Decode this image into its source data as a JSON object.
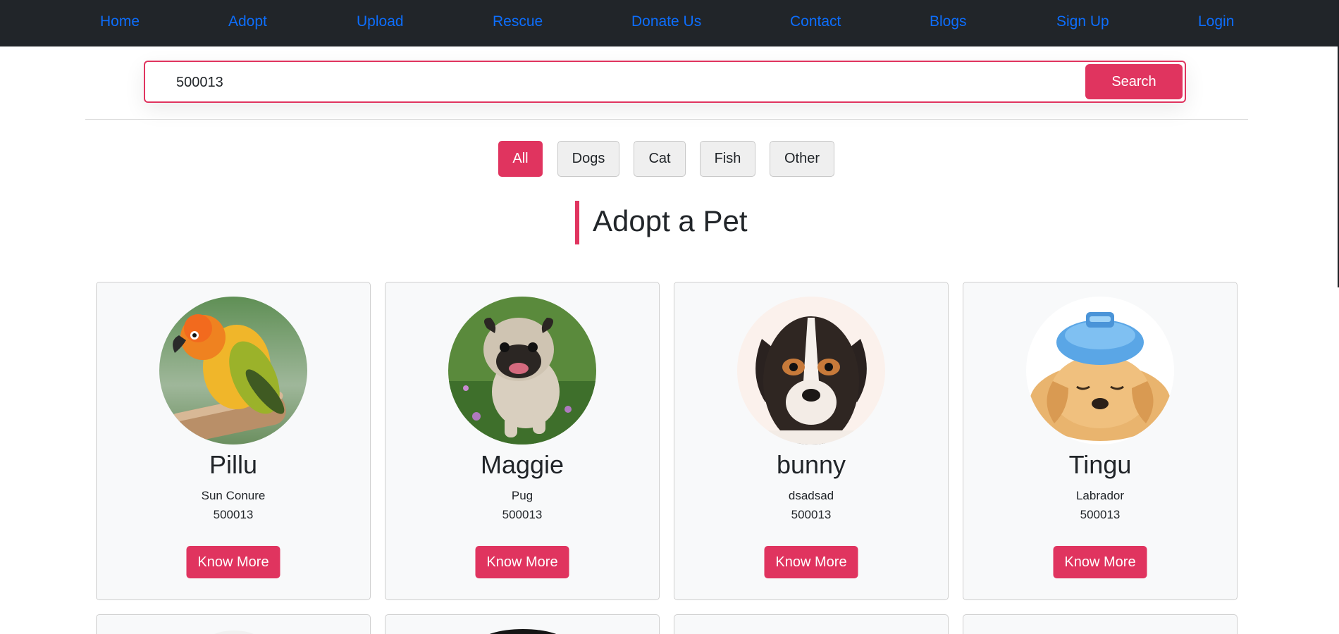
{
  "nav": {
    "items": [
      "Home",
      "Adopt",
      "Upload",
      "Rescue",
      "Donate Us",
      "Contact",
      "Blogs",
      "Sign Up",
      "Login"
    ]
  },
  "search": {
    "value": "500013",
    "button_label": "Search"
  },
  "filters": [
    "All",
    "Dogs",
    "Cat",
    "Fish",
    "Other"
  ],
  "active_filter": "All",
  "heading": "Adopt a Pet",
  "colors": {
    "accent": "#e0345f",
    "nav_bg": "#212529",
    "link": "#0d6efd"
  },
  "pets": [
    {
      "name": "Pillu",
      "breed": "Sun Conure",
      "pincode": "500013",
      "button_label": "Know More",
      "image": "parrot-photo"
    },
    {
      "name": "Maggie",
      "breed": "Pug",
      "pincode": "500013",
      "button_label": "Know More",
      "image": "pug-photo"
    },
    {
      "name": "bunny",
      "breed": "dsadsad",
      "pincode": "500013",
      "button_label": "Know More",
      "image": "puppy-photo"
    },
    {
      "name": "Tingu",
      "breed": "Labrador",
      "pincode": "500013",
      "button_label": "Know More",
      "image": "golden-puppy-photo"
    }
  ]
}
